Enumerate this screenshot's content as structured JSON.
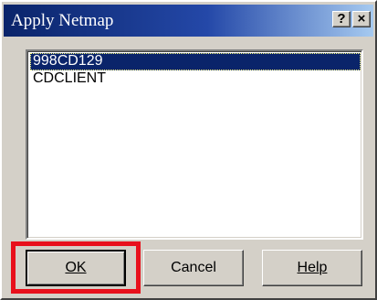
{
  "window": {
    "title": "Apply Netmap"
  },
  "titlebar": {
    "help_glyph": "?",
    "close_glyph": "×"
  },
  "list": {
    "items": [
      {
        "label": "998CD129",
        "selected": true
      },
      {
        "label": "CDCLIENT",
        "selected": false
      }
    ]
  },
  "buttons": {
    "ok": "OK",
    "cancel": "Cancel",
    "help": "Help"
  },
  "annotation": {
    "highlight_color": "#e8101c",
    "highlight_target": "ok-button"
  },
  "colors": {
    "titlebar_start": "#0a246a",
    "titlebar_end": "#a6caf0",
    "selection": "#0a246a"
  }
}
